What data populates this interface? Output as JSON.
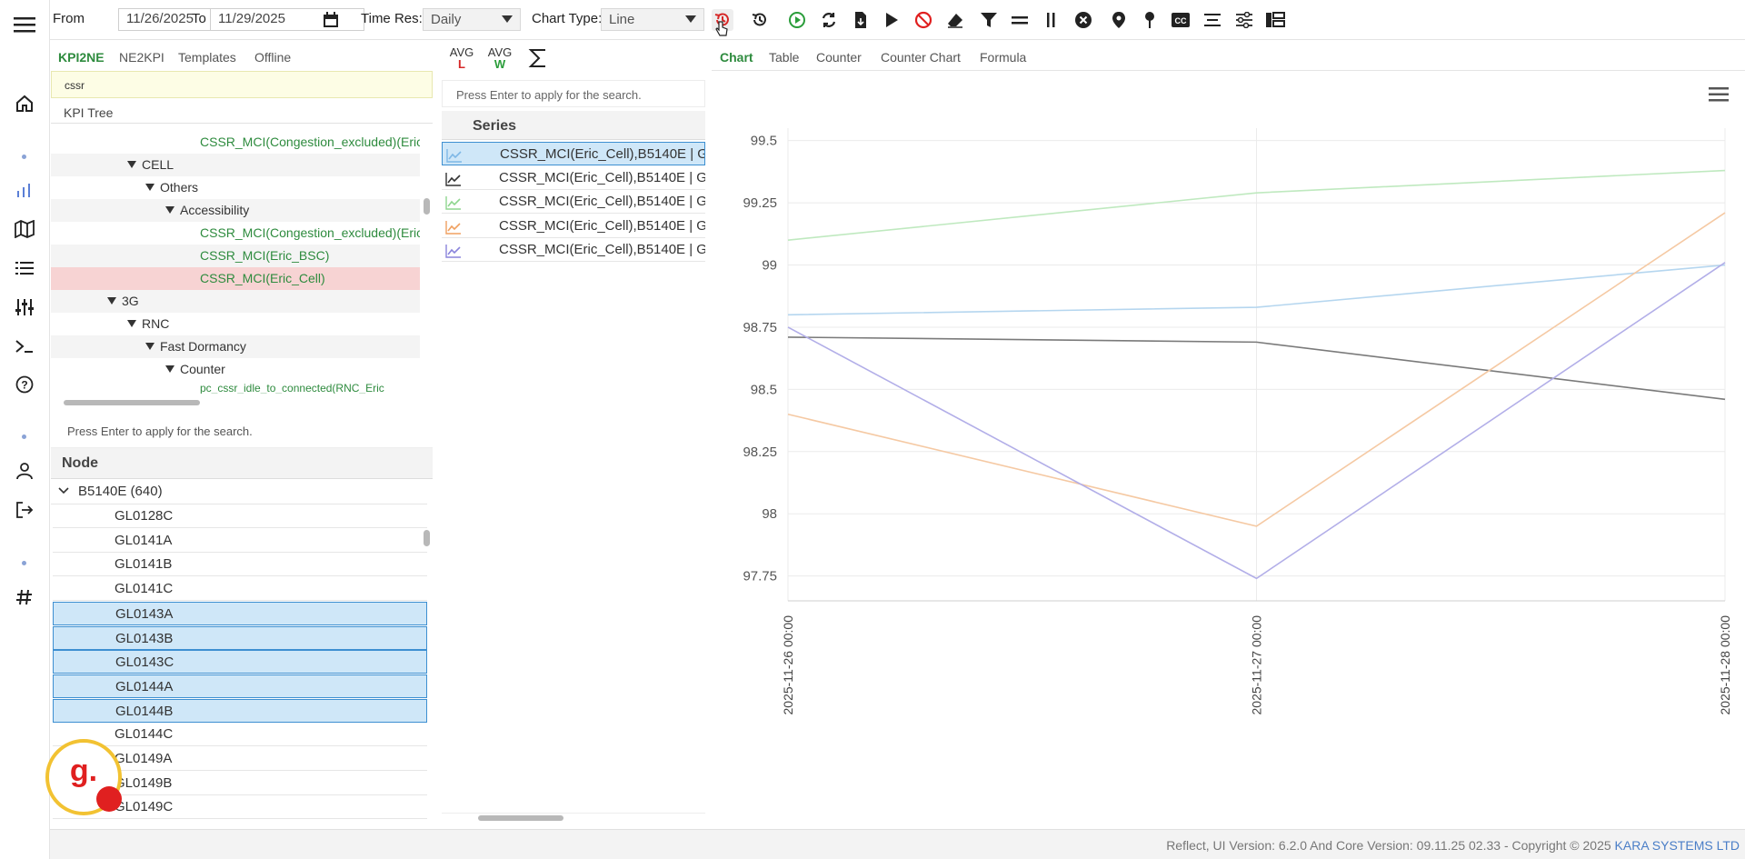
{
  "toolbar": {
    "from_label": "From",
    "from_date": "11/26/2025",
    "to_label": "To",
    "to_date": "11/29/2025",
    "timeres_label": "Time Res:",
    "timeres_value": "Daily",
    "charttype_label": "Chart Type:",
    "charttype_value": "Line"
  },
  "kpi": {
    "tabs": [
      "KPI2NE",
      "NE2KPI",
      "Templates",
      "Offline"
    ],
    "search_value": "cssr",
    "tree_header": "KPI Tree",
    "rows": [
      {
        "text": "CSSR_MCI(Congestion_excluded)(Eric",
        "kind": "leaf"
      },
      {
        "text": "CELL",
        "kind": "node"
      },
      {
        "text": "Others",
        "kind": "node"
      },
      {
        "text": "Accessibility",
        "kind": "node"
      },
      {
        "text": "CSSR_MCI(Congestion_excluded)(Eric",
        "kind": "leaf"
      },
      {
        "text": "CSSR_MCI(Eric_BSC)",
        "kind": "leaf"
      },
      {
        "text": "CSSR_MCI(Eric_Cell)",
        "kind": "leaf-selected"
      },
      {
        "text": "3G",
        "kind": "node"
      },
      {
        "text": "RNC",
        "kind": "node"
      },
      {
        "text": "Fast Dormancy",
        "kind": "node"
      },
      {
        "text": "Counter",
        "kind": "node"
      },
      {
        "text": "pc_cssr_idle_to_connected(RNC_Eric",
        "kind": "leaf"
      }
    ]
  },
  "mid": {
    "avg_l_top": "AVG",
    "avg_l_sub": "L",
    "avg_w_top": "AVG",
    "avg_w_sub": "W",
    "search_placeholder": "Press Enter to apply for the search.",
    "series_header": "Series",
    "series": [
      {
        "label": "CSSR_MCI(Eric_Cell),B5140E | GL",
        "color": "#7fb8e6"
      },
      {
        "label": "CSSR_MCI(Eric_Cell),B5140E | GL",
        "color": "#333333"
      },
      {
        "label": "CSSR_MCI(Eric_Cell),B5140E | GL",
        "color": "#8fd68f"
      },
      {
        "label": "CSSR_MCI(Eric_Cell),B5140E | GL",
        "color": "#f0a060"
      },
      {
        "label": "CSSR_MCI(Eric_Cell),B5140E | GL",
        "color": "#8a84dc"
      }
    ]
  },
  "node": {
    "search_placeholder": "Press Enter to apply for the search.",
    "header": "Node",
    "group": "B5140E (640)",
    "items": [
      {
        "label": "GL0128C",
        "selected": false
      },
      {
        "label": "GL0141A",
        "selected": false
      },
      {
        "label": "GL0141B",
        "selected": false
      },
      {
        "label": "GL0141C",
        "selected": false
      },
      {
        "label": "GL0143A",
        "selected": true
      },
      {
        "label": "GL0143B",
        "selected": true
      },
      {
        "label": "GL0143C",
        "selected": true
      },
      {
        "label": "GL0144A",
        "selected": true
      },
      {
        "label": "GL0144B",
        "selected": true
      },
      {
        "label": "GL0144C",
        "selected": false
      },
      {
        "label": "GL0149A",
        "selected": false
      },
      {
        "label": "GL0149B",
        "selected": false
      },
      {
        "label": "GL0149C",
        "selected": false
      }
    ],
    "logo_text": "g."
  },
  "chart": {
    "tabs": [
      "Chart",
      "Table",
      "Counter",
      "Counter Chart",
      "Formula"
    ]
  },
  "chart_data": {
    "type": "line",
    "x": [
      "2025-11-26 00:00",
      "2025-11-27 00:00",
      "2025-11-28 00:00"
    ],
    "yticks": [
      "99.5",
      "99.25",
      "99",
      "98.75",
      "98.5",
      "98.25",
      "98",
      "97.75"
    ],
    "ylim": [
      97.65,
      99.55
    ],
    "grid": true,
    "series": [
      {
        "color": "#b5d6ef",
        "values": [
          98.8,
          98.83,
          99.0
        ]
      },
      {
        "color": "#7a7a7a",
        "values": [
          98.71,
          98.69,
          98.46
        ]
      },
      {
        "color": "#bfe9bf",
        "values": [
          99.1,
          99.29,
          99.38
        ]
      },
      {
        "color": "#f5c9a3",
        "values": [
          98.4,
          97.95,
          99.21
        ]
      },
      {
        "color": "#b2aee8",
        "values": [
          98.75,
          97.74,
          99.01
        ]
      }
    ]
  },
  "footer": {
    "text": "Reflect, UI Version: 6.2.0 And Core Version: 09.11.25 02.33 - Copyright © 2025",
    "brand": "KARA SYSTEMS LTD"
  }
}
